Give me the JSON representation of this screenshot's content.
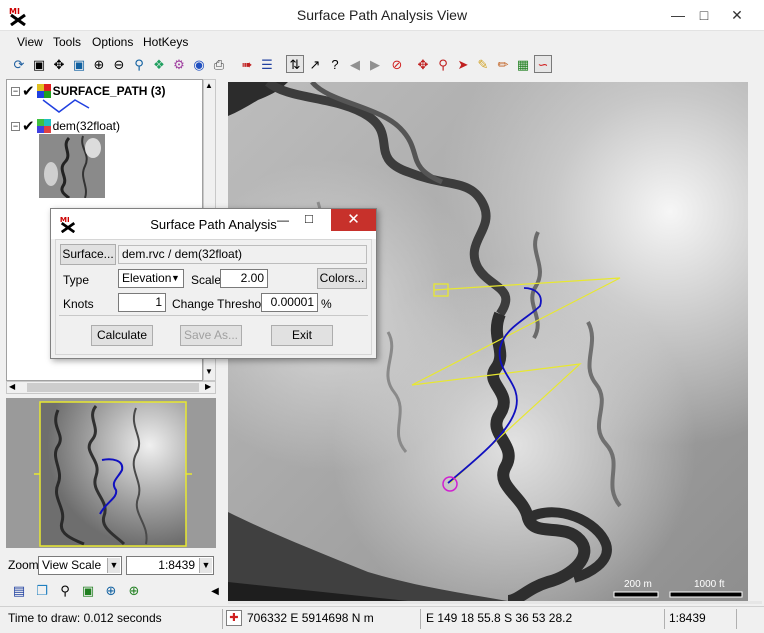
{
  "window": {
    "title": "Surface Path Analysis View"
  },
  "menu": [
    "View",
    "Tools",
    "Options",
    "HotKeys"
  ],
  "layers": [
    {
      "name": "SURFACE_PATH (3)"
    },
    {
      "name": "dem(32float)"
    }
  ],
  "zoom": {
    "label": "Zoom",
    "mode": "View Scale",
    "scale": "1:8439"
  },
  "map": {
    "scale_bar_metric": "200 m",
    "scale_bar_imperial": "1000 ft",
    "colors": {
      "path": "#1010c0",
      "profile_line": "#e8e830",
      "start_marker": "#d020d0"
    }
  },
  "status": {
    "draw_time": "Time to draw: 0.012 seconds",
    "coordinates": "706332 E  5914698 N m",
    "latlon": "E 149 18 55.8  S 36 53 28.2",
    "scale": "1:8439"
  },
  "dialog": {
    "title": "Surface Path Analysis",
    "surface_button": "Surface...",
    "surface_value": "dem.rvc / dem(32float)",
    "type_label": "Type",
    "type_value": "Elevation",
    "scale_label": "Scale",
    "scale_value": "2.00",
    "colors_button": "Colors...",
    "knots_label": "Knots",
    "knots_value": "1",
    "threshold_label": "Change Threshold",
    "threshold_value": "0.00001",
    "threshold_unit": "%",
    "calculate_button": "Calculate",
    "save_button": "Save As...",
    "exit_button": "Exit"
  }
}
